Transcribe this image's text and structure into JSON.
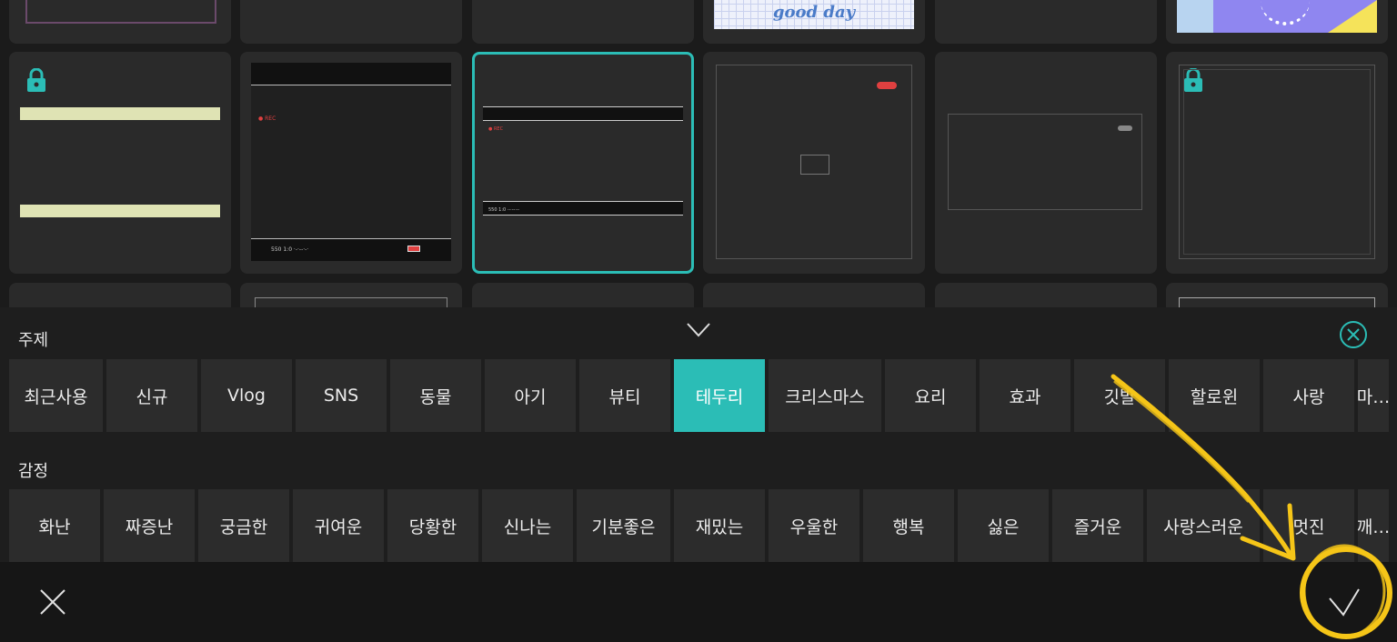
{
  "colors": {
    "accent": "#2bbdb6",
    "annotation": "#f5c518"
  },
  "themes": {
    "label": "주제",
    "chips": [
      "최근사용",
      "신규",
      "Vlog",
      "SNS",
      "동물",
      "아기",
      "뷰티",
      "테두리",
      "크리스마스",
      "요리",
      "효과",
      "깃발",
      "할로윈",
      "사랑",
      "마…"
    ],
    "active": "테두리"
  },
  "emotions": {
    "label": "감정",
    "chips": [
      "화난",
      "짜증난",
      "궁금한",
      "귀여운",
      "당황한",
      "신나는",
      "기분좋은",
      "재밌는",
      "우울한",
      "행복",
      "싫은",
      "즐거운",
      "사랑스러운",
      "멋진",
      "깨…"
    ]
  },
  "tiles": {
    "top_row_text": "good day",
    "cam1": {
      "rec": "● REC",
      "status": "550   1:0   ·-·--·-·"
    },
    "cam2": {
      "rec": "● REC",
      "status": "550   1:0   ·-·--·-·"
    }
  },
  "icons": {
    "collapse": "chevron-down-icon",
    "close_panel": "close-circle-icon",
    "cancel": "close-icon",
    "confirm": "checkmark-icon",
    "lock": "lock-icon"
  }
}
